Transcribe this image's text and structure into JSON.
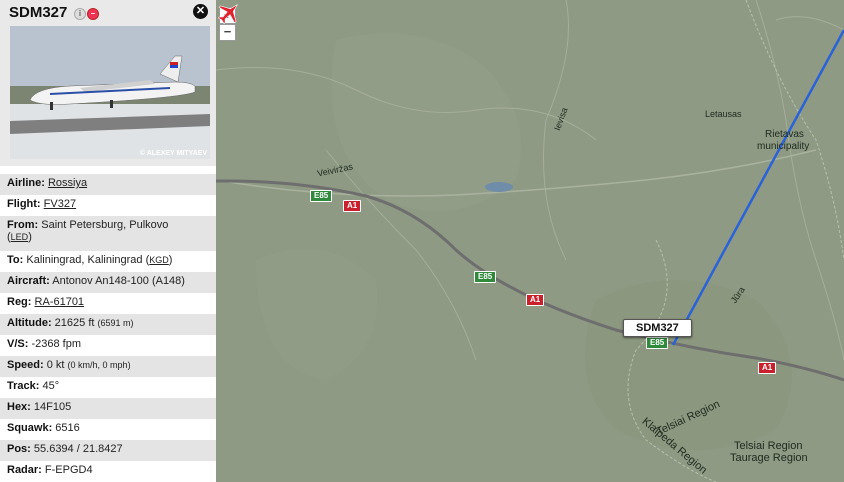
{
  "flight": {
    "callsign": "SDM327",
    "photo_credit": "© ALEXEY MITYAEV",
    "airline_label": "Airline:",
    "airline": "Rossiya",
    "flight_label": "Flight:",
    "flight_number": "FV327",
    "from_label": "From:",
    "from_city": "Saint Petersburg, Pulkovo",
    "from_code": "LED",
    "to_label": "To:",
    "to_city": "Kaliningrad, Kaliningrad",
    "to_code": "KGD",
    "aircraft_label": "Aircraft:",
    "aircraft": "Antonov An148-100 (A148)",
    "reg_label": "Reg:",
    "reg": "RA-61701",
    "altitude_label": "Altitude:",
    "altitude": "21625 ft",
    "altitude_m": "(6591 m)",
    "vs_label": "V/S:",
    "vs": "-2368 fpm",
    "speed_label": "Speed:",
    "speed": "0 kt",
    "speed_alt": "(0 km/h, 0 mph)",
    "track_label": "Track:",
    "track": "45°",
    "hex_label": "Hex:",
    "hex": "14F105",
    "squawk_label": "Squawk:",
    "squawk": "6516",
    "pos_label": "Pos:",
    "pos": "55.6394 / 21.8427",
    "radar_label": "Radar:",
    "radar": "F-EPGD4"
  },
  "map": {
    "zoom_in": "+",
    "zoom_out": "−",
    "flight_tag": "SDM327",
    "labels": {
      "letausas": "Letausas",
      "rietavas_1": "Rietavas",
      "rietavas_2": "municipality",
      "veiviržas": "Veiviržas",
      "ievisa": "Ievisa",
      "jura": "Jūra",
      "telsiai_1": "Telsiai Region",
      "klaipeda": "Klaipeda Region",
      "telsiai_2": "Telsiai Region",
      "taurage": "Taurage Region"
    },
    "shields": {
      "e85_1": "E85",
      "e85_2": "E85",
      "e85_3": "E85",
      "a1_1": "A1",
      "a1_2": "A1",
      "a1_3": "A1"
    },
    "colors": {
      "track_line": "#2a62d9",
      "aircraft": "#e0222e",
      "road": "#6e6e6e"
    }
  }
}
